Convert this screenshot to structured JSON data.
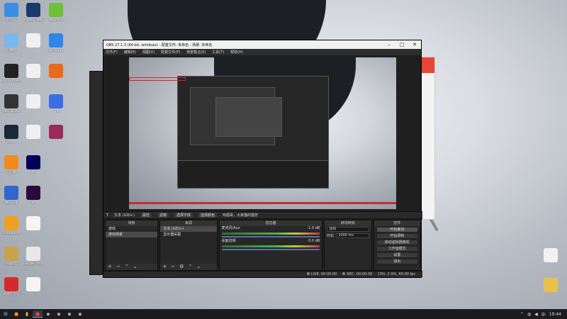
{
  "desktop": {
    "icons_left": [
      {
        "label": "此电脑",
        "icon": "computer-icon",
        "color": "#3a8ee6"
      },
      {
        "label": "回收站",
        "icon": "recycle-bin-icon",
        "color": "#7ab7ea"
      },
      {
        "label": "Epic Games Launcher",
        "icon": "epic-games-icon",
        "color": "#222222"
      },
      {
        "label": "OBS Studio",
        "icon": "obs-icon",
        "color": "#333333"
      },
      {
        "label": "Steam",
        "icon": "steam-icon",
        "color": "#1b2838"
      },
      {
        "label": "向日葵",
        "icon": "sunflower-icon",
        "color": "#f08a1c"
      },
      {
        "label": "腾讯游戏",
        "icon": "game-icon",
        "color": "#3366cc"
      },
      {
        "label": "Overwatch",
        "icon": "overwatch-icon",
        "color": "#f0a020"
      },
      {
        "label": "英雄联盟",
        "icon": "lol-icon",
        "color": "#c9a24b"
      },
      {
        "label": "网易云音乐",
        "icon": "netease-music-icon",
        "color": "#d8282f"
      }
    ],
    "icons_col2": [
      {
        "label": "英雄联盟 WeGame版",
        "icon": "lol-wegame-icon",
        "color": "#1a3a6a"
      },
      {
        "label": "",
        "icon": "blank-icon",
        "color": "#f0f0f0"
      },
      {
        "label": "",
        "icon": "blank-icon",
        "color": "#f0f0f0"
      },
      {
        "label": "",
        "icon": "blank-icon",
        "color": "#f0f0f0"
      },
      {
        "label": "",
        "icon": "blank-icon",
        "color": "#f0f0f0"
      },
      {
        "label": "Au",
        "icon": "audition-icon",
        "color": "#00005b"
      },
      {
        "label": "Pr",
        "icon": "premiere-icon",
        "color": "#2a0a3d"
      },
      {
        "label": "",
        "icon": "document-icon",
        "color": "#f4f4f4"
      },
      {
        "label": "Google Chrome",
        "icon": "chrome-icon",
        "color": "#e8e8e8"
      },
      {
        "label": "",
        "icon": "document-icon",
        "color": "#f4f4f4"
      }
    ],
    "icons_col3": [
      {
        "label": "WeGame",
        "icon": "wegame-icon",
        "color": "#6fbf3a"
      },
      {
        "label": "UU加速器",
        "icon": "uu-icon",
        "color": "#2f86e8"
      },
      {
        "label": "",
        "icon": "app-icon",
        "color": "#e86a1a"
      },
      {
        "label": "飞书",
        "icon": "feishu-icon",
        "color": "#3a6ee8"
      },
      {
        "label": "",
        "icon": "app-icon",
        "color": "#9a2a5a"
      }
    ],
    "icons_right": [
      {
        "label": "",
        "icon": "document-icon",
        "color": "#f2f2f2"
      },
      {
        "label": "",
        "icon": "folder-icon",
        "color": "#e8c24a"
      }
    ]
  },
  "obs": {
    "title": "OBS 27.1.3 (64-bit, windows) - 配置文件: 未命名 - 场景: 未命名",
    "menu": [
      "文件(F)",
      "编辑(E)",
      "视图(V)",
      "配置文件(P)",
      "场景集合(S)",
      "工具(T)",
      "帮助(H)"
    ],
    "source_bar": {
      "source_name": "文本 (GDI+)",
      "properties": "属性",
      "filters": "滤镜",
      "font_label": "选择字体",
      "color_label": "选择颜色",
      "text_preview": "鸡翅哥，大家猫的猎狩"
    },
    "scenes": {
      "header": "场景",
      "items": [
        "游戏",
        "游戏场景"
      ]
    },
    "sources": {
      "header": "来源",
      "items": [
        "文本 (GDI+)",
        "显示器采集"
      ]
    },
    "mixer": {
      "header": "混音器",
      "channels": [
        {
          "name": "麦克风/Aux",
          "db": "-1.0 dB"
        },
        {
          "name": "桌面音频",
          "db": "0.0 dB"
        }
      ]
    },
    "transitions": {
      "header": "转场特效",
      "type": "淡出",
      "duration_label": "时长",
      "duration_value": "1000 ms"
    },
    "controls": {
      "header": "控件",
      "buttons": [
        "开始推流",
        "开始录制",
        "启动虚拟摄像机",
        "工作室模式",
        "设置",
        "退出"
      ]
    },
    "status": {
      "live": "LIVE: 00:00:00",
      "rec": "REC: 00:00:00",
      "cpu": "CPU: 2.9%, 60.00 fps"
    }
  },
  "taskbar": {
    "time": "19:44",
    "tray_icons": [
      "chevron-up-icon",
      "network-icon",
      "volume-icon",
      "input-method-icon"
    ]
  }
}
